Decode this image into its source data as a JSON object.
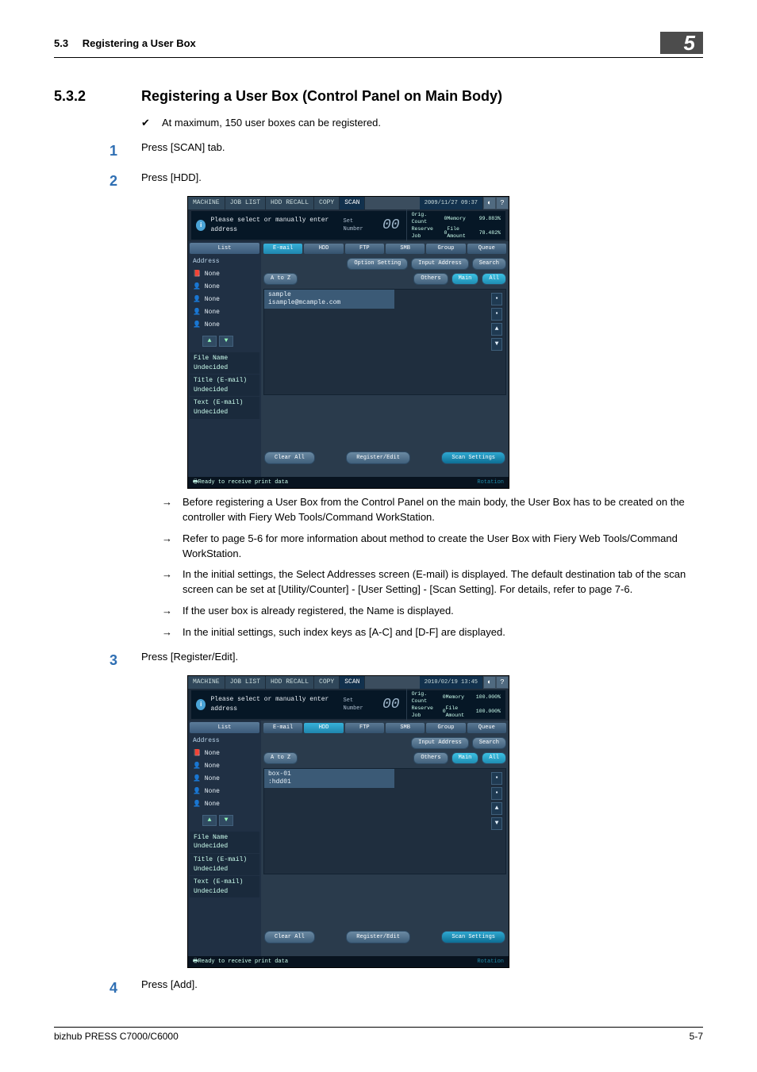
{
  "header": {
    "section_number": "5.3",
    "section_title": "Registering a User Box",
    "chapter_badge": "5"
  },
  "section": {
    "number": "5.3.2",
    "title": "Registering a User Box (Control Panel on Main Body)"
  },
  "body": {
    "note_max": "At maximum, 150 user boxes can be registered.",
    "step1_text": "Press [SCAN] tab.",
    "step2_text": "Press [HDD].",
    "arrow1": "Before registering a User Box from the Control Panel on the main body, the User Box has to be created on the controller with Fiery Web Tools/Command WorkStation.",
    "arrow2": "Refer to page 5-6 for more information about method to create the User Box with Fiery Web Tools/Command WorkStation.",
    "arrow3": "In the initial settings, the Select Addresses screen (E-mail) is displayed.  The default destination tab of the scan screen can be set at [Utility/Counter] - [User Setting] - [Scan Setting]. For details, refer to page 7-6.",
    "arrow4": "If the user box is already registered, the Name is displayed.",
    "arrow5": "In the initial settings, such index keys as [A-C] and [D-F] are displayed.",
    "step3_text": "Press [Register/Edit].",
    "step4_text": "Press [Add]."
  },
  "markers": {
    "check": "✔",
    "arrow": "→",
    "s1": "1",
    "s2": "2",
    "s3": "3",
    "s4": "4"
  },
  "screenshot1": {
    "top_tabs": {
      "machine": "MACHINE",
      "joblist": "JOB LIST",
      "hddrecall": "HDD RECALL",
      "copy": "COPY",
      "scan": "SCAN"
    },
    "datetime": "2009/11/27 09:37",
    "info_msg": "Please select or manually enter address",
    "set_number_label": "Set Number",
    "set_number_value": "00",
    "stats": {
      "orig": "Orig. Count",
      "orig_v": "0",
      "reserve": "Reserve Job",
      "reserve_v": "0",
      "mem": "Memory",
      "mem_v": "99.883%",
      "file": "File Amount",
      "file_v": "78.482%"
    },
    "side_list": "List",
    "side_addr": "Address",
    "side_none": "None",
    "tabs": {
      "email": "E-mail",
      "hdd": "HDD",
      "ftp": "FTP",
      "smb": "SMB",
      "group": "Group",
      "queue": "Queue"
    },
    "opt": "Option Setting",
    "input": "Input Address",
    "search": "Search",
    "atoz": "A to Z",
    "others": "Others",
    "main": "Main",
    "all": "All",
    "entry_name": "sample",
    "entry_sub": "isample@mcample.com",
    "filename": "File Name",
    "title": "Title (E-mail)",
    "text": "Text (E-mail)",
    "undec": "Undecided",
    "clearall": "Clear All",
    "regedit": "Register/Edit",
    "scanset": "Scan Settings",
    "status": "Ready to receive print data",
    "rotation": "Rotation"
  },
  "screenshot2": {
    "datetime": "2010/02/19 13:45",
    "stats_mem_v": "100.000%",
    "stats_file_v": "100.000%",
    "entry_name": "box-01",
    "entry_sub": ":hdd01"
  },
  "footer": {
    "product": "bizhub PRESS C7000/C6000",
    "pagenum": "5-7"
  }
}
